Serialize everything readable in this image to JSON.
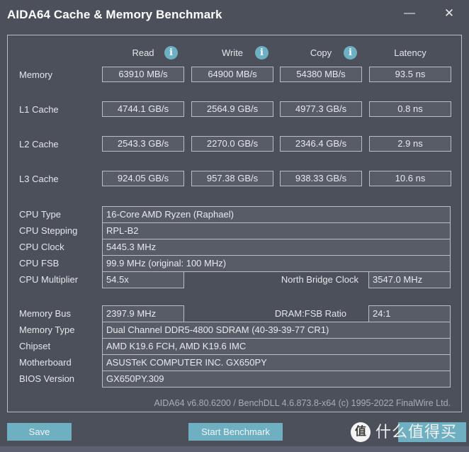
{
  "window": {
    "title": "AIDA64 Cache & Memory Benchmark",
    "minimize_glyph": "—",
    "close_glyph": "✕"
  },
  "columns": {
    "read": "Read",
    "write": "Write",
    "copy": "Copy",
    "latency": "Latency",
    "info_glyph": "i"
  },
  "bench_rows": [
    {
      "label": "Memory",
      "read": "63910 MB/s",
      "write": "64900 MB/s",
      "copy": "54380 MB/s",
      "latency": "93.5 ns"
    },
    {
      "label": "L1 Cache",
      "read": "4744.1 GB/s",
      "write": "2564.9 GB/s",
      "copy": "4977.3 GB/s",
      "latency": "0.8 ns"
    },
    {
      "label": "L2 Cache",
      "read": "2543.3 GB/s",
      "write": "2270.0 GB/s",
      "copy": "2346.4 GB/s",
      "latency": "2.9 ns"
    },
    {
      "label": "L3 Cache",
      "read": "924.05 GB/s",
      "write": "957.38 GB/s",
      "copy": "938.33 GB/s",
      "latency": "10.6 ns"
    }
  ],
  "cpu_info": {
    "cpu_type": {
      "label": "CPU Type",
      "value": "16-Core AMD Ryzen  (Raphael)"
    },
    "cpu_stepping": {
      "label": "CPU Stepping",
      "value": "RPL-B2"
    },
    "cpu_clock": {
      "label": "CPU Clock",
      "value": "5445.3 MHz"
    },
    "cpu_fsb": {
      "label": "CPU FSB",
      "value": "99.9 MHz  (original: 100 MHz)"
    },
    "cpu_multiplier": {
      "label": "CPU Multiplier",
      "value": "54.5x"
    },
    "nb_clock": {
      "label": "North Bridge Clock",
      "value": "3547.0 MHz"
    }
  },
  "mem_info": {
    "memory_bus": {
      "label": "Memory Bus",
      "value": "2397.9 MHz"
    },
    "dram_ratio": {
      "label": "DRAM:FSB Ratio",
      "value": "24:1"
    },
    "memory_type": {
      "label": "Memory Type",
      "value": "Dual Channel DDR5-4800 SDRAM  (40-39-39-77 CR1)"
    },
    "chipset": {
      "label": "Chipset",
      "value": "AMD K19.6 FCH, AMD K19.6 IMC"
    },
    "motherboard": {
      "label": "Motherboard",
      "value": "ASUSTeK COMPUTER INC. GX650PY"
    },
    "bios": {
      "label": "BIOS Version",
      "value": "GX650PY.309"
    }
  },
  "footer": {
    "version_text": "AIDA64 v6.80.6200 / BenchDLL 4.6.873.8-x64  (c) 1995-2022 FinalWire Ltd."
  },
  "buttons": {
    "save": "Save",
    "start_benchmark": "Start Benchmark"
  },
  "watermark": {
    "badge": "值",
    "text": "什么值得买"
  },
  "colors": {
    "background": "#4b505a",
    "accent": "#6eb0c1",
    "border": "#b8bcc4",
    "value_box": "#585c67"
  }
}
